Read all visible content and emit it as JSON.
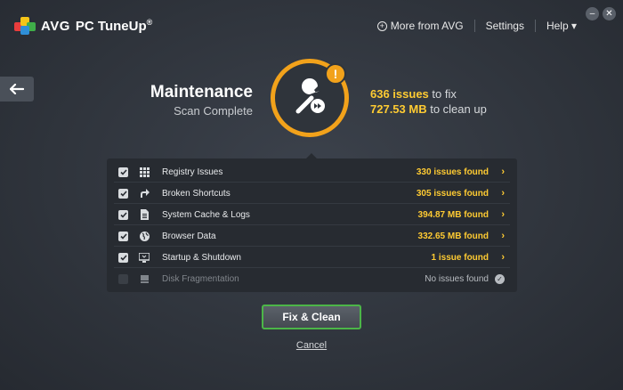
{
  "app": {
    "brand": "AVG",
    "product": "PC TuneUp",
    "product_mark": "®"
  },
  "topnav": {
    "more": "More from AVG",
    "settings": "Settings",
    "help": "Help ▾"
  },
  "window": {
    "minimize": "–",
    "close": "✕"
  },
  "header": {
    "title": "Maintenance",
    "subtitle": "Scan Complete",
    "issues_count": "636 issues",
    "issues_label": "to fix",
    "size_count": "727.53 MB",
    "size_label": "to clean up",
    "alert_glyph": "!"
  },
  "items": [
    {
      "label": "Registry Issues",
      "value": "330 issues found",
      "checked": true,
      "icon": "grid-icon"
    },
    {
      "label": "Broken Shortcuts",
      "value": "305 issues found",
      "checked": true,
      "icon": "shortcut-arrow-icon"
    },
    {
      "label": "System Cache & Logs",
      "value": "394.87 MB found",
      "checked": true,
      "icon": "cache-files-icon"
    },
    {
      "label": "Browser Data",
      "value": "332.65 MB found",
      "checked": true,
      "icon": "globe-icon"
    },
    {
      "label": "Startup & Shutdown",
      "value": "1 issue found",
      "checked": true,
      "icon": "monitor-icon"
    },
    {
      "label": "Disk Fragmentation",
      "value": "No issues found",
      "checked": false,
      "icon": "disk-icon"
    }
  ],
  "actions": {
    "fix": "Fix & Clean",
    "cancel": "Cancel"
  },
  "colors": {
    "accent": "#f2a21b",
    "highlight": "#ffcb32",
    "button_border": "#4cb648",
    "background": "#30353d"
  }
}
